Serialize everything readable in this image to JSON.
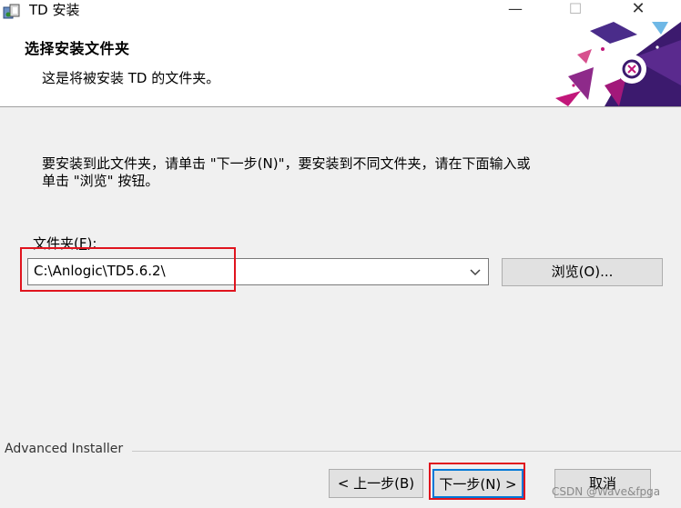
{
  "window": {
    "title": "TD 安装",
    "minimize_glyph": "—",
    "maximize_glyph": "☐",
    "close_glyph": "✕"
  },
  "header": {
    "title": "选择安装文件夹",
    "subtitle": "这是将被安装 TD 的文件夹。"
  },
  "instructions": {
    "line1": "要安装到此文件夹，请单击 \"下一步(N)\"，要安装到不同文件夹，请在下面输入或",
    "line2": "单击 \"浏览\" 按钮。"
  },
  "folder": {
    "label_main": "文件夹(",
    "label_hotkey": "F",
    "label_end": "):",
    "value": "C:\\Anlogic\\TD5.6.2\\"
  },
  "buttons": {
    "browse": "浏览(O)...",
    "back": "< 上一步(B)",
    "next": "下一步(N) >",
    "cancel": "取消"
  },
  "footer": {
    "brand": "Advanced Installer"
  },
  "watermark": "CSDN @Wave&fpga",
  "colors": {
    "highlight_red": "#e0141e",
    "highlight_blue": "#1a5fd8",
    "logo_purple": "#3c1a6e",
    "logo_magenta": "#c2177a"
  }
}
